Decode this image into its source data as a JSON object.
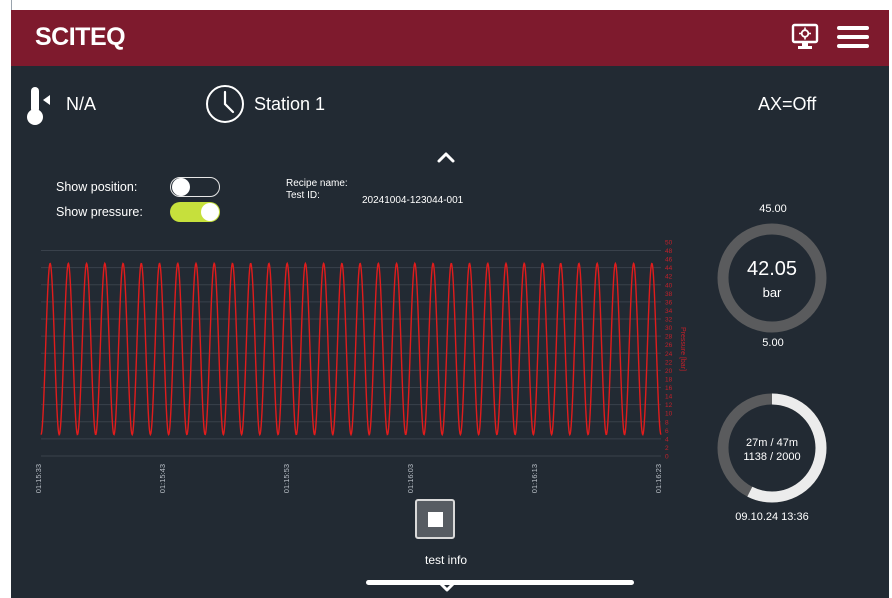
{
  "header": {
    "brand": "SCITEQ",
    "icons": [
      "monitor-settings-icon",
      "hamburger-menu-icon"
    ]
  },
  "status": {
    "temperature": "N/A",
    "station": "Station 1",
    "ax_status": "AX=Off"
  },
  "toggles": {
    "show_position": {
      "label": "Show position:",
      "on": false
    },
    "show_pressure": {
      "label": "Show pressure:",
      "on": true
    }
  },
  "recipe": {
    "name_label": "Recipe name:",
    "name_value": "",
    "test_id_label": "Test ID:",
    "test_id_value": "20241004-123044-001"
  },
  "pressure_gauge": {
    "max_label": "45.00",
    "value": "42.05",
    "unit": "bar",
    "min_label": "5.00",
    "min": 5,
    "max": 45,
    "current": 42.05
  },
  "progress_gauge": {
    "time_text": "27m / 47m",
    "cycles_text": "1138  / 2000",
    "date_text": "09.10.24  13:36",
    "fraction": 0.574
  },
  "controls": {
    "stop_label": "stop",
    "test_info": "test info"
  },
  "colors": {
    "header": "#7e1a2d",
    "background": "#222a33",
    "trace": "#e01c1c",
    "toggle_on": "#c6e03c",
    "gauge_track": "#5a5b5d",
    "progress_fill": "#ececec"
  },
  "chart_data": {
    "type": "line",
    "title": "",
    "xlabel": "",
    "ylabel": "Pressure [bar]",
    "x_ticks": [
      "01:15:33",
      "01:15:43",
      "01:15:53",
      "01:16:03",
      "01:16:13",
      "01:16:23"
    ],
    "y_ticks": [
      0,
      2,
      4,
      6,
      8,
      10,
      12,
      14,
      16,
      18,
      20,
      22,
      24,
      26,
      28,
      30,
      32,
      34,
      36,
      38,
      40,
      42,
      44,
      46,
      48,
      50
    ],
    "ylim": [
      0,
      50
    ],
    "series": [
      {
        "values_description_note": "",
        "min": 5,
        "max": 45,
        "cycles": 34
      }
    ],
    "grid": true
  }
}
